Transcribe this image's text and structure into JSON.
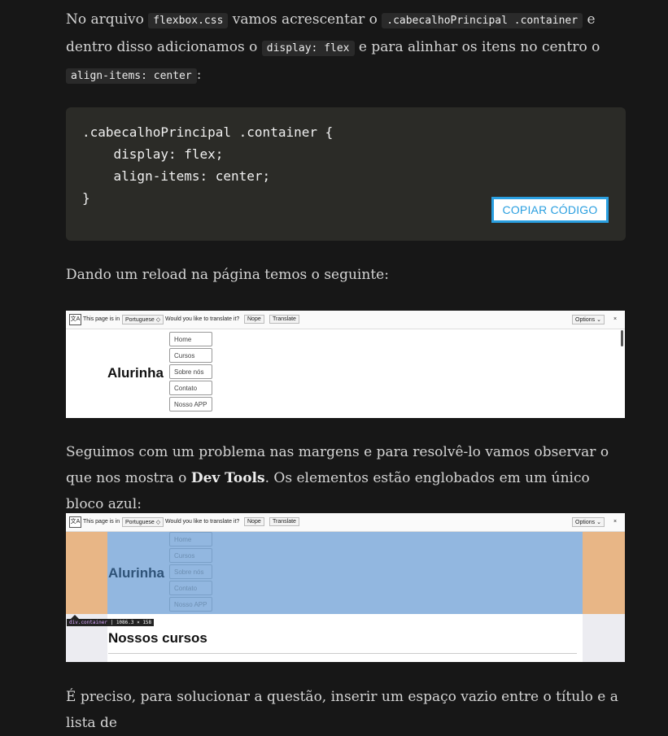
{
  "intro": {
    "t1": "No arquivo ",
    "code1": "flexbox.css",
    "t2": " vamos acrescentar o ",
    "code2": ".cabecalhoPrincipal .container",
    "t3": " e dentro disso adicionamos o ",
    "code3": "display: flex",
    "t4": " e para alinhar os itens no centro o ",
    "code4": "align-items: center",
    "t5": ":"
  },
  "code_block": {
    "code": ".cabecalhoPrincipal .container {\n    display: flex;\n    align-items: center;\n}",
    "copy_label": "COPIAR CÓDIGO"
  },
  "para2": "Dando um reload na página temos o seguinte:",
  "para3": {
    "t1": "Seguimos com um problema nas margens e para resolvê-lo vamos observar o que nos mostra o ",
    "bold": "Dev Tools",
    "t2": ". Os elementos estão englobados em um único bloco azul:"
  },
  "para4": "É preciso, para solucionar a questão, inserir um espaço vazio entre o título e a lista de",
  "translate_bar": {
    "icon": "translate-icon",
    "page_is_in": "This page is in",
    "language": "Portuguese ◇",
    "question": "Would you like to translate it?",
    "nope": "Nope",
    "translate": "Translate",
    "options": "Options   ⌄",
    "close": "×"
  },
  "site": {
    "logo": "Alurinha",
    "nav": [
      "Home",
      "Cursos",
      "Sobre nós",
      "Contato",
      "Nosso APP"
    ],
    "section_title": "Nossos cursos"
  },
  "devtools": {
    "selector": "div.container",
    "size": "1086.3 × 158"
  },
  "colors": {
    "background": "#171717",
    "code_bg": "#2b2b27",
    "accent": "#2a9fe0",
    "margin_orange": "#e8b686",
    "content_blue": "#92b7e0"
  }
}
